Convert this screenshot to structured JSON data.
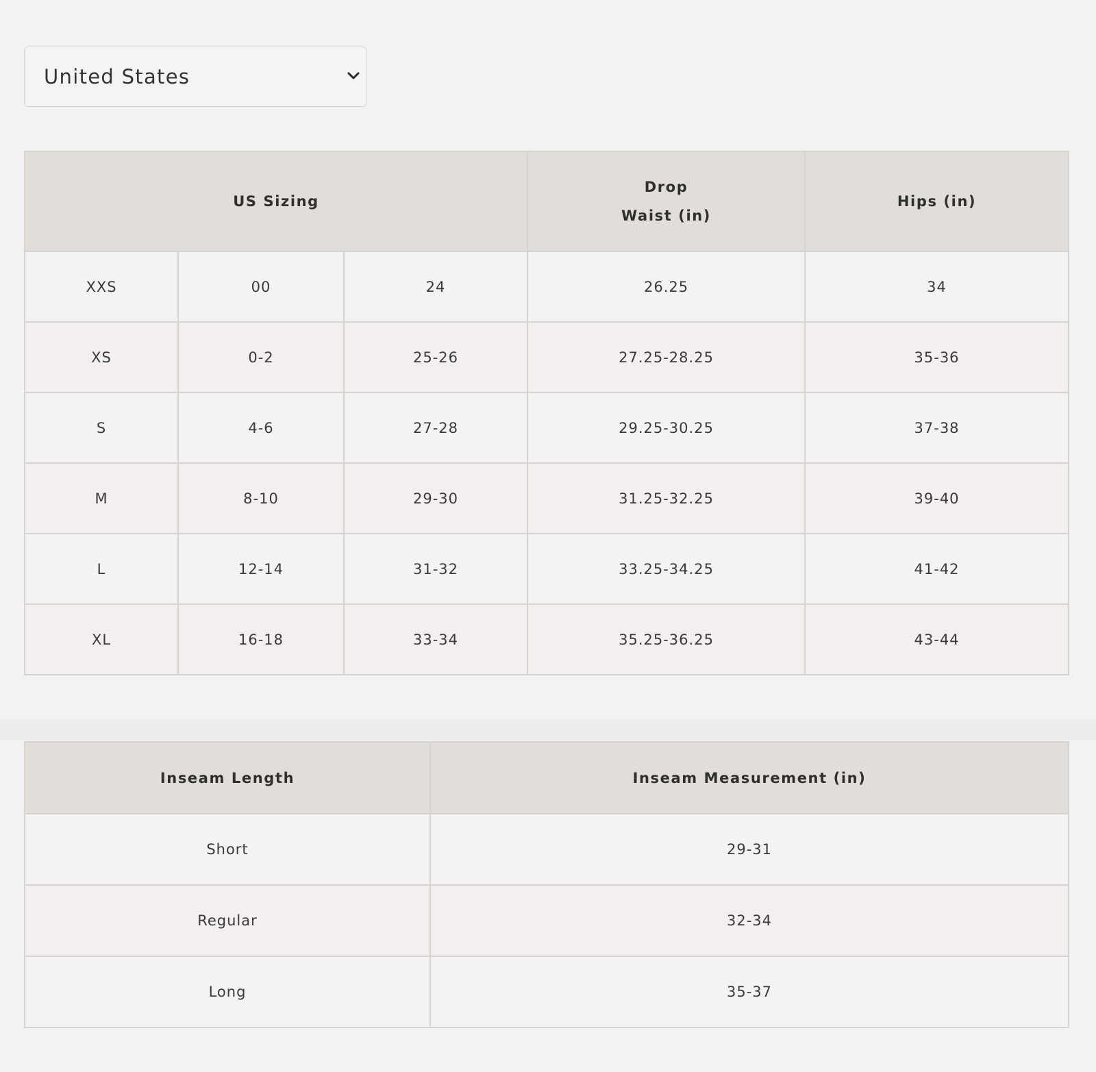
{
  "country_select": {
    "selected": "United States",
    "caret_icon": "chevron-down-icon"
  },
  "size_chart": {
    "headers": {
      "sizing": "US Sizing",
      "drop_waist_line1": "Drop",
      "drop_waist_line2": "Waist (in)",
      "hips": "Hips (in)"
    },
    "rows": [
      {
        "letter": "XXS",
        "us": "00",
        "waist": "24",
        "drop_waist": "26.25",
        "hips": "34"
      },
      {
        "letter": "XS",
        "us": "0-2",
        "waist": "25-26",
        "drop_waist": "27.25-28.25",
        "hips": "35-36"
      },
      {
        "letter": "S",
        "us": "4-6",
        "waist": "27-28",
        "drop_waist": "29.25-30.25",
        "hips": "37-38"
      },
      {
        "letter": "M",
        "us": "8-10",
        "waist": "29-30",
        "drop_waist": "31.25-32.25",
        "hips": "39-40"
      },
      {
        "letter": "L",
        "us": "12-14",
        "waist": "31-32",
        "drop_waist": "33.25-34.25",
        "hips": "41-42"
      },
      {
        "letter": "XL",
        "us": "16-18",
        "waist": "33-34",
        "drop_waist": "35.25-36.25",
        "hips": "43-44"
      }
    ]
  },
  "inseam_chart": {
    "headers": {
      "length": "Inseam Length",
      "measurement": "Inseam Measurement (in)"
    },
    "rows": [
      {
        "length": "Short",
        "measurement": "29-31"
      },
      {
        "length": "Regular",
        "measurement": "32-34"
      },
      {
        "length": "Long",
        "measurement": "35-37"
      }
    ]
  }
}
